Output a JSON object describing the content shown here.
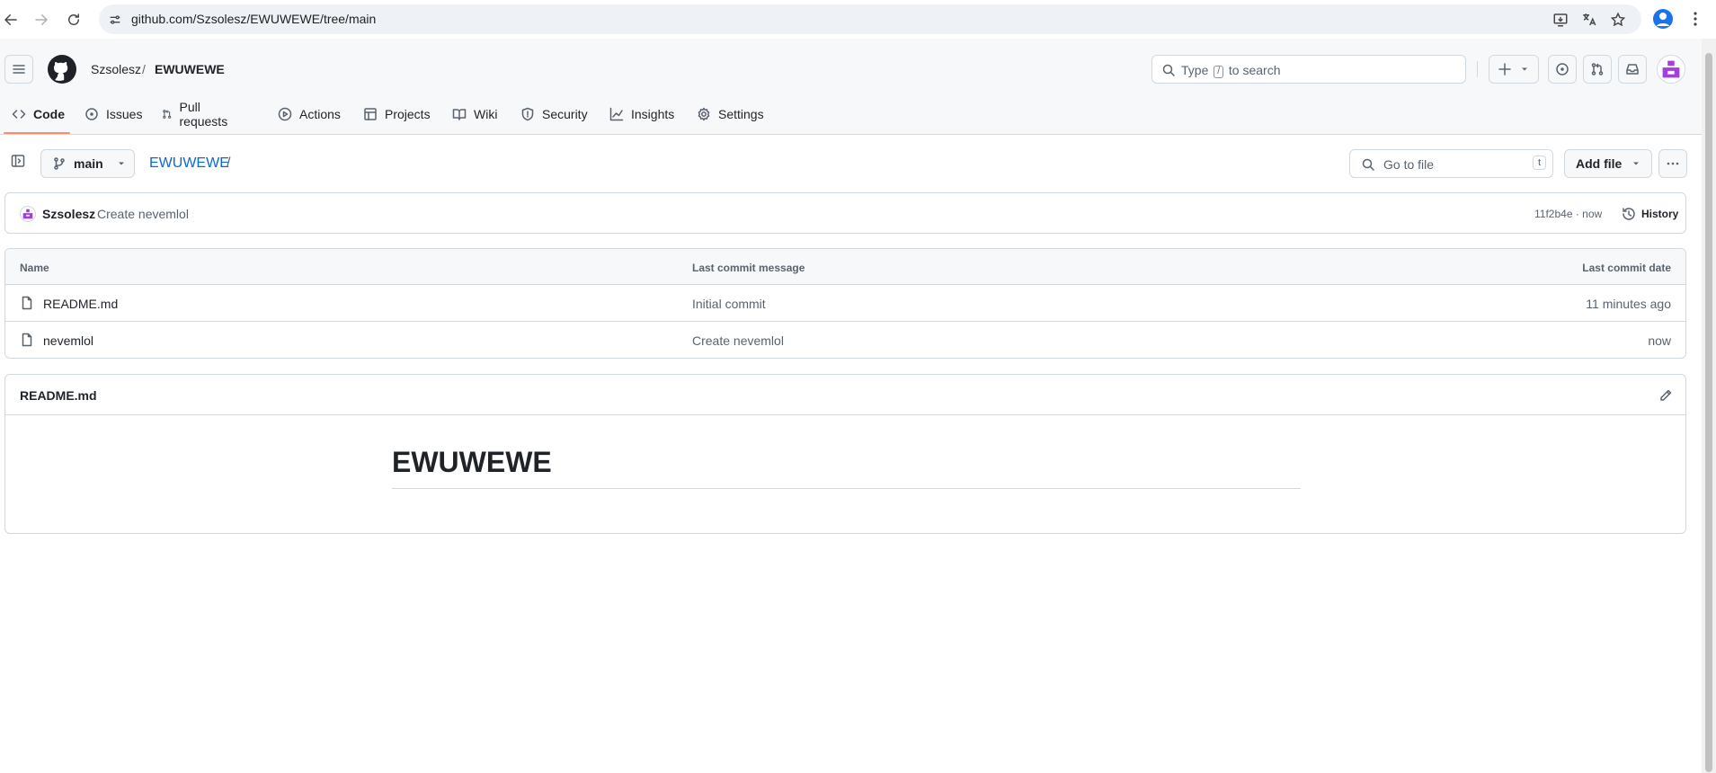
{
  "browser": {
    "url": "github.com/Szsolesz/EWUWEWE/tree/main"
  },
  "header": {
    "owner": "Szsolesz",
    "separator": "/",
    "repo": "EWUWEWE",
    "search_placeholder_pre": "Type",
    "search_key": "/",
    "search_placeholder_post": "to search"
  },
  "repo_nav": [
    {
      "label": "Code",
      "icon": "code-icon",
      "active": true
    },
    {
      "label": "Issues",
      "icon": "issue-icon"
    },
    {
      "label": "Pull requests",
      "icon": "pull-request-icon"
    },
    {
      "label": "Actions",
      "icon": "play-icon"
    },
    {
      "label": "Projects",
      "icon": "table-icon"
    },
    {
      "label": "Wiki",
      "icon": "book-icon"
    },
    {
      "label": "Security",
      "icon": "shield-icon"
    },
    {
      "label": "Insights",
      "icon": "graph-icon"
    },
    {
      "label": "Settings",
      "icon": "gear-icon"
    }
  ],
  "toolbar": {
    "branch": "main",
    "path_repo": "EWUWEWE",
    "path_sep": "/",
    "goto_placeholder": "Go to file",
    "goto_key": "t",
    "add_file": "Add file"
  },
  "commit": {
    "author": "Szsolesz",
    "message": "Create nevemlol",
    "meta": "11f2b4e · now",
    "history": "History"
  },
  "files": {
    "columns": [
      "Name",
      "Last commit message",
      "Last commit date"
    ],
    "rows": [
      {
        "name": "README.md",
        "message": "Initial commit",
        "date": "11 minutes ago"
      },
      {
        "name": "nevemlol",
        "message": "Create nevemlol",
        "date": "now"
      }
    ]
  },
  "readme": {
    "title": "README.md",
    "heading": "EWUWEWE"
  },
  "colors": {
    "accent_link": "#0969da",
    "active_tab_underline": "#fd8c73",
    "avatar_purple": "#a33ee0"
  }
}
